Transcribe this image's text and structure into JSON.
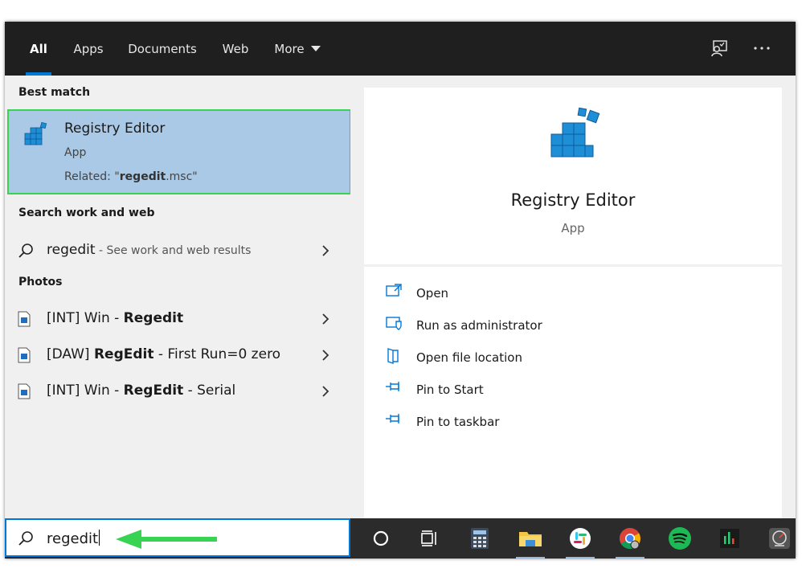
{
  "tabs": [
    {
      "label": "All",
      "active": true
    },
    {
      "label": "Apps"
    },
    {
      "label": "Documents"
    },
    {
      "label": "Web"
    },
    {
      "label": "More"
    }
  ],
  "top_icons": [
    "feedback-icon",
    "more-options-icon"
  ],
  "sections": {
    "best_match": "Best match",
    "search_web": "Search work and web",
    "photos": "Photos"
  },
  "best_match": {
    "title": "Registry Editor",
    "type": "App",
    "related_prefix": "Related: \"",
    "related_bold": "regedit",
    "related_suffix": ".msc\"",
    "icon": "registry-editor-icon"
  },
  "web_result": {
    "query": "regedit",
    "suffix": " - See work and web results"
  },
  "photos": [
    {
      "pre": "[INT] Win - ",
      "bold": "Regedit",
      "post": ""
    },
    {
      "pre": "[DAW] ",
      "bold": "RegEdit",
      "post": " - First Run=0 zero"
    },
    {
      "pre": "[INT] Win - ",
      "bold": "RegEdit",
      "post": " - Serial"
    }
  ],
  "detail": {
    "title": "Registry Editor",
    "type": "App"
  },
  "actions": [
    {
      "label": "Open",
      "icon": "open-icon"
    },
    {
      "label": "Run as administrator",
      "icon": "shield-icon"
    },
    {
      "label": "Open file location",
      "icon": "file-location-icon"
    },
    {
      "label": "Pin to Start",
      "icon": "pin-icon"
    },
    {
      "label": "Pin to taskbar",
      "icon": "pin-icon"
    }
  ],
  "search": {
    "value": "regedit"
  },
  "taskbar": [
    "cortana-icon",
    "task-view-icon",
    "calculator-icon",
    "file-explorer-icon",
    "slack-icon",
    "chrome-icon",
    "spotify-icon",
    "audio-app-icon",
    "speedometer-icon"
  ],
  "colors": {
    "accent": "#0078d7",
    "highlight": "#a9c9e6",
    "annotation_green": "#39d353"
  }
}
